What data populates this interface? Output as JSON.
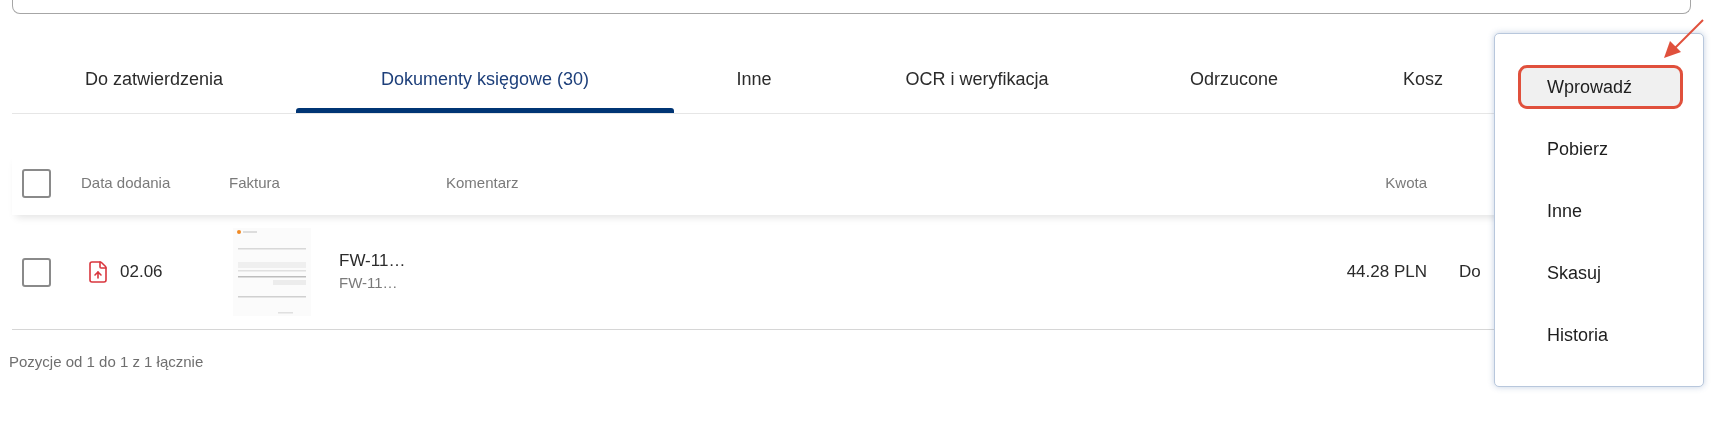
{
  "tabs": [
    {
      "label": "Do zatwierdzenia",
      "selected": false
    },
    {
      "label": "Dokumenty księgowe (30)",
      "selected": true
    },
    {
      "label": "Inne",
      "selected": false
    },
    {
      "label": "OCR i weryfikacja",
      "selected": false
    },
    {
      "label": "Odrzucone",
      "selected": false
    },
    {
      "label": "Kosz",
      "selected": false
    }
  ],
  "table": {
    "select_all": {
      "checked": false
    },
    "columns": [
      "Data dodania",
      "Faktura",
      "Komentarz",
      "Kwota"
    ],
    "rows": [
      {
        "checked": false,
        "date": "02.06",
        "invoice": "FW-11…",
        "invoice_sub": "FW-11…",
        "amount": "44.28 PLN",
        "status": "Do"
      }
    ]
  },
  "footer": "Pozycje od 1 do 1 z 1 łącznie",
  "menu": {
    "items": [
      {
        "label": "Wprowadź",
        "selected": true
      },
      {
        "label": "Pobierz",
        "selected": false
      },
      {
        "label": "Inne",
        "selected": false
      },
      {
        "label": "Skasuj",
        "selected": false
      },
      {
        "label": "Historia",
        "selected": false
      }
    ]
  }
}
